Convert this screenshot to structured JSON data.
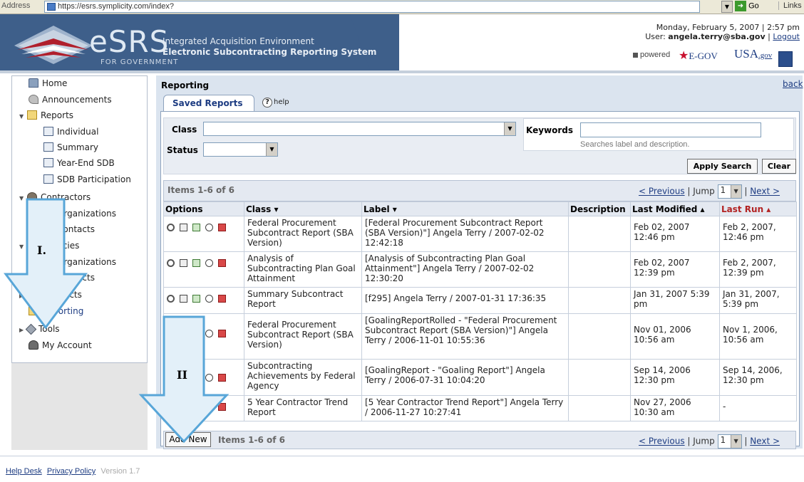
{
  "browser": {
    "address_label": "Address",
    "url": "https://esrs.symplicity.com/index?",
    "go_label": "Go",
    "links_label": "Links"
  },
  "header": {
    "logo_text": "eSRS",
    "logo_sub": "FOR GOVERNMENT",
    "title_line1": "Integrated Acquisition Environment",
    "title_line2": "Electronic Subcontracting Reporting System",
    "datetime": "Monday, February 5, 2007 | 2:57 pm",
    "user_prefix": "User: ",
    "user_email": "angela.terry@sba.gov",
    "separator": " | ",
    "logout": "Logout",
    "powered": "powered",
    "egov": "E-GOV",
    "usagov": "USA",
    "usagov_suffix": ".gov"
  },
  "sidebar": {
    "home": "Home",
    "announcements": "Announcements",
    "reports": "Reports",
    "individual": "Individual",
    "summary": "Summary",
    "year_end_sdb": "Year-End SDB",
    "sdb_participation": "SDB Participation",
    "contractors": "Contractors",
    "organizations1": "Organizations",
    "contacts1": "Contacts",
    "agencies": "Agencies",
    "organizations2": "Organizations",
    "contacts2": "Contacts",
    "contracts": "Contracts",
    "reporting": "Reporting",
    "tools": "Tools",
    "my_account": "My Account"
  },
  "main": {
    "title": "Reporting",
    "back": "back",
    "tab": "Saved Reports",
    "help": "help",
    "class_label": "Class",
    "status_label": "Status",
    "keywords_label": "Keywords",
    "keywords_hint": "Searches label and description.",
    "apply_search": "Apply Search",
    "clear": "Clear",
    "items_count": "Items 1-6 of 6",
    "previous": "< Previous",
    "jump": " | Jump ",
    "jump_value": "1",
    "next": "Next >",
    "add_new": "Add New",
    "columns": [
      "Options",
      "Class ▾",
      "Label ▾",
      "Description",
      "Last Modified ▴",
      "Last Run ▴"
    ],
    "rows": [
      {
        "class": "Federal Procurement Subcontract Report (SBA Version)",
        "label": "[Federal Procurement Subcontract Report (SBA Version)\"] Angela Terry / 2007-02-02 12:42:18",
        "description": "",
        "modified": "Feb 02, 2007 12:46 pm",
        "last_run": "Feb 2, 2007, 12:46 pm"
      },
      {
        "class": "Analysis of Subcontracting Plan Goal Attainment",
        "label": "[Analysis of Subcontracting Plan Goal Attainment\"] Angela Terry / 2007-02-02 12:30:20",
        "description": "",
        "modified": "Feb 02, 2007 12:39 pm",
        "last_run": "Feb 2, 2007, 12:39 pm"
      },
      {
        "class": "Summary Subcontract Report",
        "label": "[f295] Angela Terry / 2007-01-31 17:36:35",
        "description": "",
        "modified": "Jan 31, 2007 5:39 pm",
        "last_run": "Jan 31, 2007, 5:39 pm"
      },
      {
        "class": "Federal Procurement Subcontract Report (SBA Version)",
        "label": "[GoalingReportRolled - \"Federal Procurement Subcontract Report (SBA Version)\"] Angela Terry / 2006-11-01 10:55:36",
        "description": "",
        "modified": "Nov 01, 2006 10:56 am",
        "last_run": "Nov 1, 2006, 10:56 am"
      },
      {
        "class": "Subcontracting Achievements by Federal Agency",
        "label": "[GoalingReport - \"Goaling Report\"] Angela Terry / 2006-07-31 10:04:20",
        "description": "",
        "modified": "Sep 14, 2006 12:30 pm",
        "last_run": "Sep 14, 2006, 12:30 pm"
      },
      {
        "class": "5 Year Contractor Trend Report",
        "label": "[5 Year Contractor Trend Report\"] Angela Terry / 2006-11-27 10:27:41",
        "description": "",
        "modified": "Nov 27, 2006 10:30 am",
        "last_run": "-"
      }
    ]
  },
  "footer": {
    "help_desk": "Help Desk",
    "privacy": "Privacy Policy",
    "version": "Version 1.7"
  },
  "annotations": {
    "arrow1": "I.",
    "arrow2": "II"
  }
}
